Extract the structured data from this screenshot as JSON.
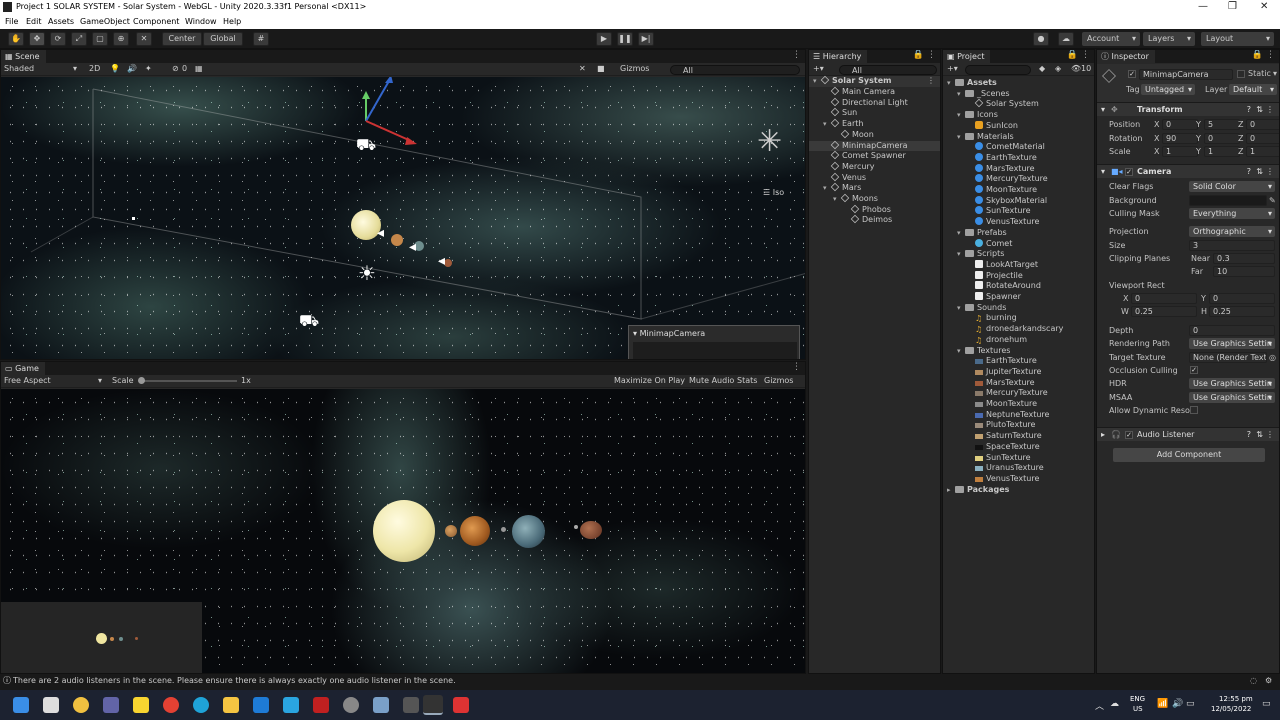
{
  "window": {
    "title": "Project 1 SOLAR SYSTEM - Solar System - WebGL - Unity 2020.3.33f1 Personal <DX11>"
  },
  "menu": [
    "File",
    "Edit",
    "Assets",
    "GameObject",
    "Component",
    "Window",
    "Help"
  ],
  "toolbar": {
    "center": "Center",
    "global": "Global",
    "account": "Account",
    "layers": "Layers",
    "layout": "Layout"
  },
  "scene": {
    "tab": "Scene",
    "shading": "Shaded",
    "mode2d": "2D",
    "gizmos": "Gizmos",
    "search": "All",
    "iso_label": "Iso",
    "hidden_count": "0",
    "preview_title": "MinimapCamera"
  },
  "game": {
    "tab": "Game",
    "aspect": "Free Aspect",
    "scale_label": "Scale",
    "scale_value": "1x",
    "maximize": "Maximize On Play",
    "mute": "Mute Audio",
    "stats": "Stats",
    "gizmos": "Gizmos"
  },
  "hierarchy": {
    "tab": "Hierarchy",
    "search": "All",
    "root": "Solar System",
    "items": [
      {
        "label": "Main Camera",
        "depth": 1
      },
      {
        "label": "Directional Light",
        "depth": 1
      },
      {
        "label": "Sun",
        "depth": 1
      },
      {
        "label": "Earth",
        "depth": 1,
        "expanded": true
      },
      {
        "label": "Moon",
        "depth": 2
      },
      {
        "label": "MinimapCamera",
        "depth": 1,
        "selected": true
      },
      {
        "label": "Comet Spawner",
        "depth": 1
      },
      {
        "label": "Mercury",
        "depth": 1
      },
      {
        "label": "Venus",
        "depth": 1
      },
      {
        "label": "Mars",
        "depth": 1,
        "expanded": true
      },
      {
        "label": "Moons",
        "depth": 2,
        "expanded": true
      },
      {
        "label": "Phobos",
        "depth": 3
      },
      {
        "label": "Deimos",
        "depth": 3
      }
    ]
  },
  "project": {
    "tab": "Project",
    "badge": "10",
    "items": [
      {
        "label": "Assets",
        "depth": 0,
        "type": "folder",
        "bold": true
      },
      {
        "label": "_Scenes",
        "depth": 1,
        "type": "folder"
      },
      {
        "label": "Solar System",
        "depth": 2,
        "type": "scene"
      },
      {
        "label": "Icons",
        "depth": 1,
        "type": "folder"
      },
      {
        "label": "SunIcon",
        "depth": 2,
        "type": "icon"
      },
      {
        "label": "Materials",
        "depth": 1,
        "type": "folder"
      },
      {
        "label": "CometMaterial",
        "depth": 2,
        "type": "material"
      },
      {
        "label": "EarthTexture",
        "depth": 2,
        "type": "material"
      },
      {
        "label": "MarsTexture",
        "depth": 2,
        "type": "material"
      },
      {
        "label": "MercuryTexture",
        "depth": 2,
        "type": "material"
      },
      {
        "label": "MoonTexture",
        "depth": 2,
        "type": "material"
      },
      {
        "label": "SkyboxMaterial",
        "depth": 2,
        "type": "material"
      },
      {
        "label": "SunTexture",
        "depth": 2,
        "type": "material"
      },
      {
        "label": "VenusTexture",
        "depth": 2,
        "type": "material"
      },
      {
        "label": "Prefabs",
        "depth": 1,
        "type": "folder"
      },
      {
        "label": "Comet",
        "depth": 2,
        "type": "prefab"
      },
      {
        "label": "Scripts",
        "depth": 1,
        "type": "folder"
      },
      {
        "label": "LookAtTarget",
        "depth": 2,
        "type": "script"
      },
      {
        "label": "Projectile",
        "depth": 2,
        "type": "script"
      },
      {
        "label": "RotateAround",
        "depth": 2,
        "type": "script"
      },
      {
        "label": "Spawner",
        "depth": 2,
        "type": "script"
      },
      {
        "label": "Sounds",
        "depth": 1,
        "type": "folder"
      },
      {
        "label": "burning",
        "depth": 2,
        "type": "audio"
      },
      {
        "label": "dronedarkandscary",
        "depth": 2,
        "type": "audio"
      },
      {
        "label": "dronehum",
        "depth": 2,
        "type": "audio"
      },
      {
        "label": "Textures",
        "depth": 1,
        "type": "folder"
      },
      {
        "label": "EarthTexture",
        "depth": 2,
        "type": "texture",
        "color": "#4a6a8a"
      },
      {
        "label": "JupiterTexture",
        "depth": 2,
        "type": "texture",
        "color": "#b08a60"
      },
      {
        "label": "MarsTexture",
        "depth": 2,
        "type": "texture",
        "color": "#a05a3a"
      },
      {
        "label": "MercuryTexture",
        "depth": 2,
        "type": "texture",
        "color": "#8a7a6a"
      },
      {
        "label": "MoonTexture",
        "depth": 2,
        "type": "texture",
        "color": "#8a8a8a"
      },
      {
        "label": "NeptuneTexture",
        "depth": 2,
        "type": "texture",
        "color": "#4a6ab0"
      },
      {
        "label": "PlutoTexture",
        "depth": 2,
        "type": "texture",
        "color": "#9a8a7a"
      },
      {
        "label": "SaturnTexture",
        "depth": 2,
        "type": "texture",
        "color": "#c0a070"
      },
      {
        "label": "SpaceTexture",
        "depth": 2,
        "type": "texture",
        "color": "#111111"
      },
      {
        "label": "SunTexture",
        "depth": 2,
        "type": "texture",
        "color": "#e0d080"
      },
      {
        "label": "UranusTexture",
        "depth": 2,
        "type": "texture",
        "color": "#8ab0c0"
      },
      {
        "label": "VenusTexture",
        "depth": 2,
        "type": "texture",
        "color": "#c08040"
      },
      {
        "label": "Packages",
        "depth": 0,
        "type": "folder",
        "bold": true
      }
    ]
  },
  "inspector": {
    "tab": "Inspector",
    "object_name": "MinimapCamera",
    "static": "Static",
    "tag_label": "Tag",
    "tag": "Untagged",
    "layer_label": "Layer",
    "layer": "Default",
    "transform": {
      "title": "Transform",
      "position_label": "Position",
      "position": {
        "x": "0",
        "y": "5",
        "z": "0"
      },
      "rotation_label": "Rotation",
      "rotation": {
        "x": "90",
        "y": "0",
        "z": "0"
      },
      "scale_label": "Scale",
      "scale": {
        "x": "1",
        "y": "1",
        "z": "1"
      }
    },
    "camera": {
      "title": "Camera",
      "clear_flags_label": "Clear Flags",
      "clear_flags": "Solid Color",
      "background_label": "Background",
      "culling_mask_label": "Culling Mask",
      "culling_mask": "Everything",
      "projection_label": "Projection",
      "projection": "Orthographic",
      "size_label": "Size",
      "size": "3",
      "clipping_label": "Clipping Planes",
      "near_label": "Near",
      "near": "0.3",
      "far_label": "Far",
      "far": "10",
      "viewport_label": "Viewport Rect",
      "vx": "0",
      "vy": "0",
      "vw": "0.25",
      "vh": "0.25",
      "depth_label": "Depth",
      "depth": "0",
      "rendering_path_label": "Rendering Path",
      "rendering_path": "Use Graphics Settin",
      "target_texture_label": "Target Texture",
      "target_texture": "None (Render Textu",
      "occlusion_label": "Occlusion Culling",
      "hdr_label": "HDR",
      "hdr": "Use Graphics Settin",
      "msaa_label": "MSAA",
      "msaa": "Use Graphics Settin",
      "dynres_label": "Allow Dynamic Resol"
    },
    "audio_listener": "Audio Listener",
    "add_component": "Add Component"
  },
  "status": {
    "message": "There are 2 audio listeners in the scene. Please ensure there is always exactly one audio listener in the scene."
  },
  "taskbar": {
    "lang1": "ENG",
    "lang2": "US",
    "time": "12:55 pm",
    "date": "12/05/2022"
  }
}
